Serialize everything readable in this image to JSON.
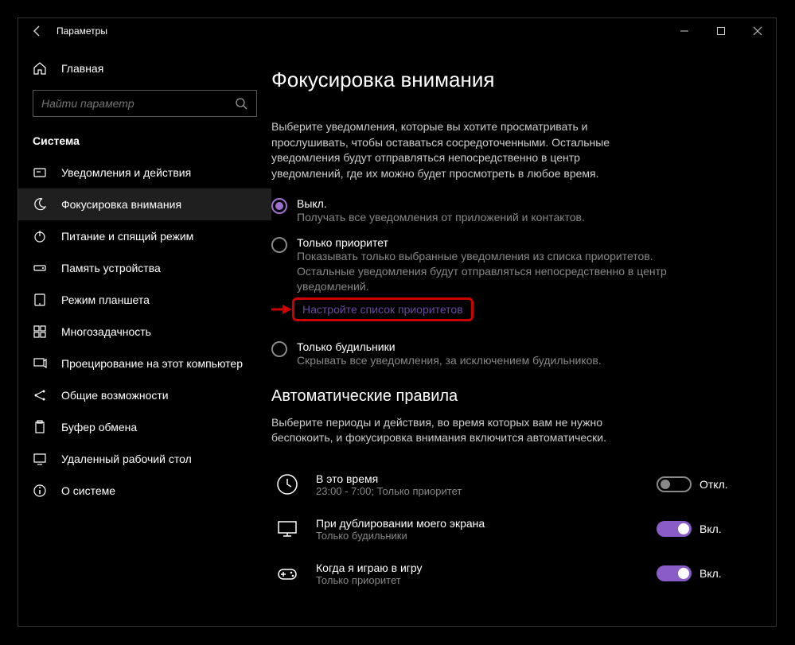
{
  "window": {
    "title": "Параметры"
  },
  "sidebar": {
    "home": "Главная",
    "search_placeholder": "Найти параметр",
    "section": "Система",
    "items": [
      {
        "label": "Уведомления и действия"
      },
      {
        "label": "Фокусировка внимания"
      },
      {
        "label": "Питание и спящий режим"
      },
      {
        "label": "Память устройства"
      },
      {
        "label": "Режим планшета"
      },
      {
        "label": "Многозадачность"
      },
      {
        "label": "Проецирование на этот компьютер"
      },
      {
        "label": "Общие возможности"
      },
      {
        "label": "Буфер обмена"
      },
      {
        "label": "Удаленный рабочий стол"
      },
      {
        "label": "О системе"
      }
    ]
  },
  "main": {
    "title": "Фокусировка внимания",
    "intro": "Выберите уведомления, которые вы хотите просматривать и прослушивать, чтобы оставаться сосредоточенными. Остальные уведомления будут отправляться непосредственно в центр уведомлений, где их можно будет просмотреть в любое время.",
    "radios": {
      "off": {
        "label": "Выкл.",
        "sub": "Получать все уведомления от приложений и контактов."
      },
      "priority": {
        "label": "Только приоритет",
        "sub": "Показывать только выбранные уведомления из списка приоритетов. Остальные уведомления будут отправляться непосредственно в центр уведомлений.",
        "link": "Настройте список приоритетов"
      },
      "alarms": {
        "label": "Только будильники",
        "sub": "Скрывать все уведомления, за исключением будильников."
      }
    },
    "auto": {
      "heading": "Автоматические правила",
      "desc": "Выберите периоды и действия, во время которых вам не нужно беспокоить, и фокусировка внимания включится автоматически.",
      "rules": [
        {
          "title": "В это время",
          "sub": "23:00 - 7:00; Только приоритет",
          "on": false,
          "state": "Откл."
        },
        {
          "title": "При дублировании моего экрана",
          "sub": "Только будильники",
          "on": true,
          "state": "Вкл."
        },
        {
          "title": "Когда я играю в игру",
          "sub": "Только приоритет",
          "on": true,
          "state": "Вкл."
        }
      ]
    }
  }
}
